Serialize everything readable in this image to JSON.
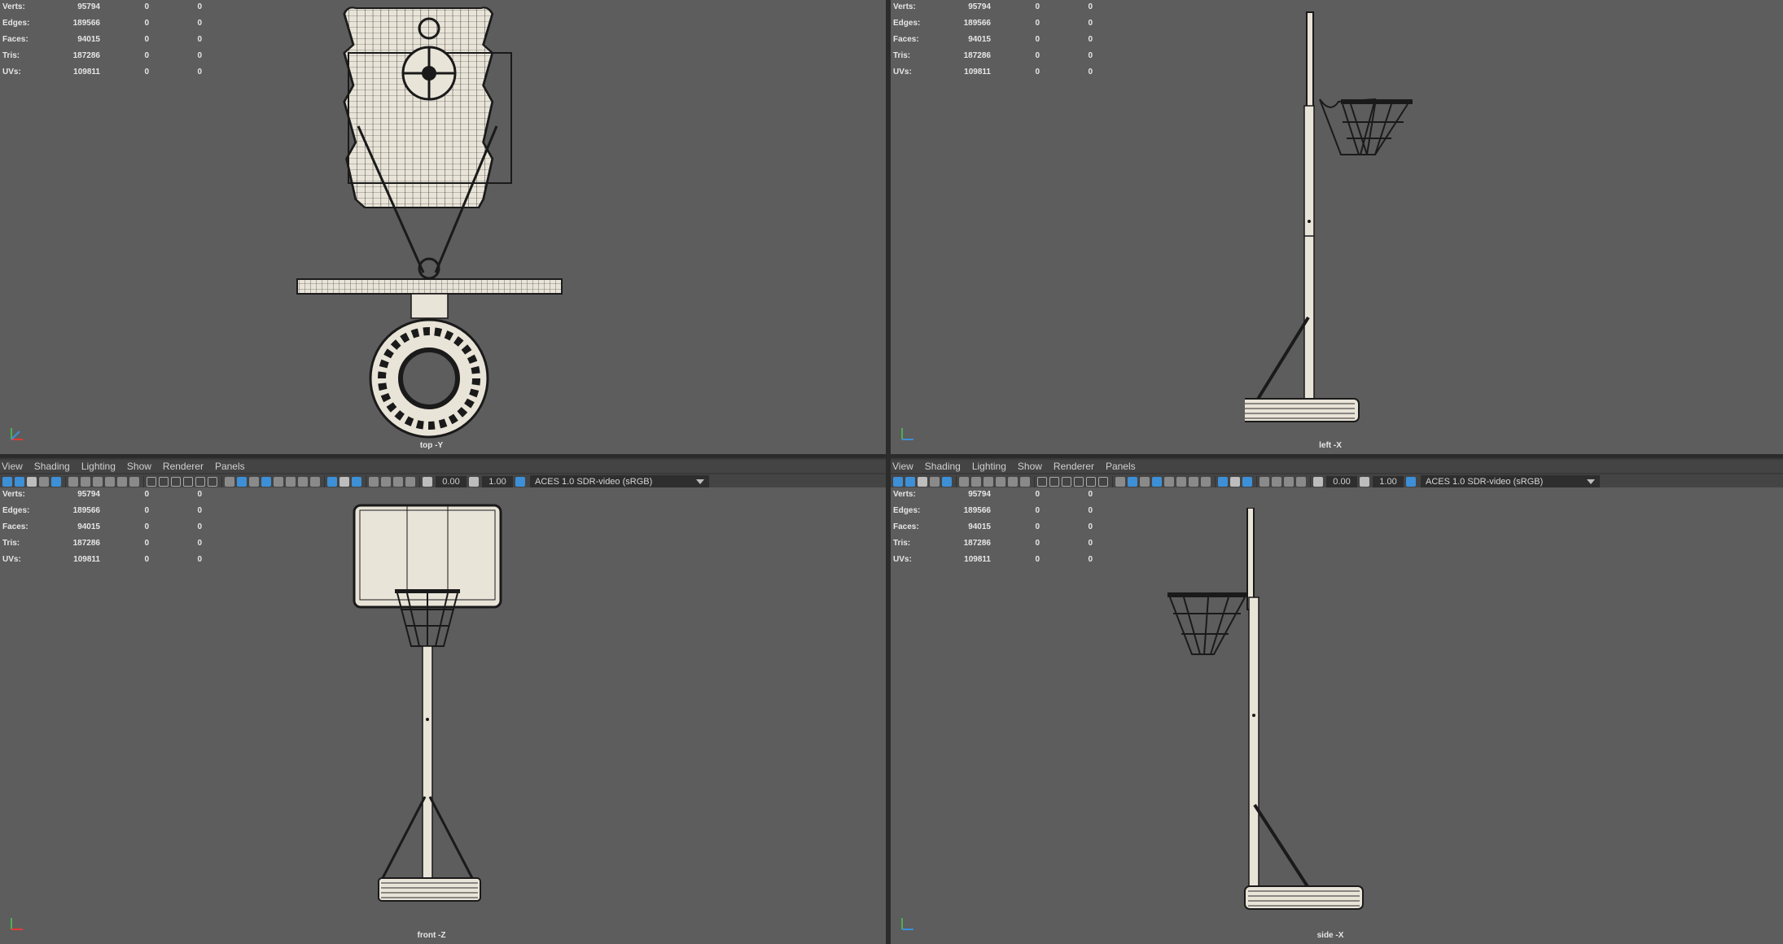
{
  "hud": [
    {
      "label": "Verts:",
      "v1": "95794",
      "v2": "0",
      "v3": "0"
    },
    {
      "label": "Edges:",
      "v1": "189566",
      "v2": "0",
      "v3": "0"
    },
    {
      "label": "Faces:",
      "v1": "94015",
      "v2": "0",
      "v3": "0"
    },
    {
      "label": "Tris:",
      "v1": "187286",
      "v2": "0",
      "v3": "0"
    },
    {
      "label": "UVs:",
      "v1": "109811",
      "v2": "0",
      "v3": "0"
    }
  ],
  "panes": {
    "top": {
      "camera": "top -Y"
    },
    "left": {
      "camera": "left -X"
    },
    "front": {
      "camera": "front -Z"
    },
    "side": {
      "camera": "side -X"
    }
  },
  "menu": {
    "left": [
      "View",
      "Shading",
      "Lighting",
      "Show",
      "Renderer",
      "Panels"
    ],
    "right": [
      "View",
      "Shading",
      "Lighting",
      "Show",
      "Renderer",
      "Panels"
    ]
  },
  "toolbar": {
    "exposure": "0.00",
    "gamma": "1.00",
    "color_space": "ACES 1.0 SDR-video (sRGB)"
  },
  "colors": {
    "viewport_bg": "#5d5d5d",
    "mesh_fill": "#e9e4d8",
    "wire": "#1a1a1a",
    "accent": "#3d8fd6"
  }
}
